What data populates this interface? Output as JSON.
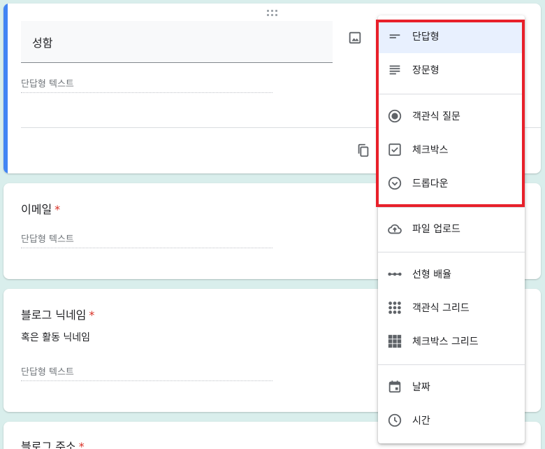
{
  "active_question": {
    "title": "성함",
    "answer_placeholder": "단답형 텍스트"
  },
  "questions": [
    {
      "title": "이메일",
      "required": "*",
      "answer_placeholder": "단답형 텍스트"
    },
    {
      "title": "블로그 닉네임",
      "required": "*",
      "description": "혹은 활동 닉네임",
      "answer_placeholder": "단답형 텍스트"
    },
    {
      "title": "블로그 주소",
      "required": "*"
    }
  ],
  "menu": {
    "items": [
      {
        "label": "단답형",
        "icon": "short-answer-icon"
      },
      {
        "label": "장문형",
        "icon": "paragraph-icon"
      },
      {
        "label": "객관식 질문",
        "icon": "radio-icon"
      },
      {
        "label": "체크박스",
        "icon": "checkbox-icon"
      },
      {
        "label": "드롭다운",
        "icon": "dropdown-icon"
      },
      {
        "label": "파일 업로드",
        "icon": "cloud-upload-icon"
      },
      {
        "label": "선형 배율",
        "icon": "linear-scale-icon"
      },
      {
        "label": "객관식 그리드",
        "icon": "radio-grid-icon"
      },
      {
        "label": "체크박스 그리드",
        "icon": "checkbox-grid-icon"
      },
      {
        "label": "날짜",
        "icon": "calendar-icon"
      },
      {
        "label": "시간",
        "icon": "clock-icon"
      }
    ],
    "selected": "단답형"
  },
  "colors": {
    "accent": "#4285f4",
    "highlight": "#e8202a",
    "selected_bg": "#e8f0fe",
    "background": "#d9eeec",
    "required": "#d93025"
  }
}
